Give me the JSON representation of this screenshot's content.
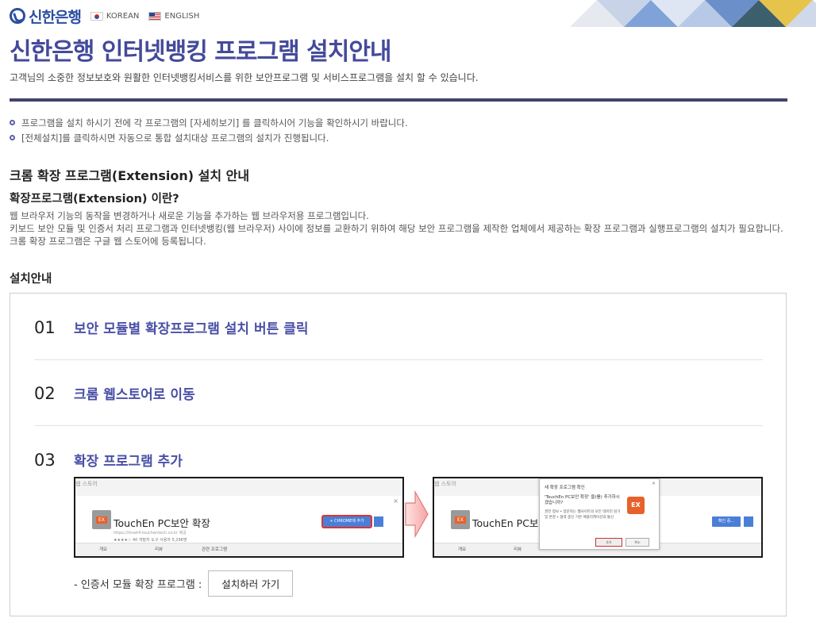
{
  "header": {
    "logo_text": "신한은행",
    "lang_korean": "KOREAN",
    "lang_english": "ENGLISH",
    "title": "신한은행 인터넷뱅킹 프로그램 설치안내",
    "subtitle": "고객님의 소중한 정보보호와 원활한 인터넷뱅킹서비스를 위한 보안프로그램 및 서비스프로그램을 설치 할 수 있습니다."
  },
  "notices": [
    "프로그램을 설치 하시기 전에 각 프로그램의 [자세히보기] 를 클릭하시어 기능을 확인하시기 바랍니다.",
    "[전체설치]를 클릭하시면 자동으로 통합 설치대상 프로그램의 설치가 진행됩니다."
  ],
  "extension": {
    "section_title": "크롬 확장 프로그램(Extension) 설치 안내",
    "question": "확장프로그램(Extension) 이란?",
    "desc_line1": "웹 브라우저 기능의 동작을 변경하거나 새로운 기능을 추가하는 웹 브라우저용 프로그램입니다.",
    "desc_line2": "키보드 보안 모듈 및 인증서 처리 프로그램과 인터넷뱅킹(웹 브라우저) 사이에 정보를 교환하기 위하여 해당 보안 프로그램을 제작한 업체에서 제공하는 확장 프로그램과 실행프로그램의 설치가 필요합니다. 크롬 확장 프로그램은 구글 웹 스토어에 등록됩니다."
  },
  "guide": {
    "title": "설치안내",
    "steps": [
      {
        "num": "01",
        "text": "보안 모듈별 확장프로그램 설치 버튼 클릭"
      },
      {
        "num": "02",
        "text": "크롬 웹스토어로 이동"
      },
      {
        "num": "03",
        "text": "확장 프로그램 추가"
      }
    ],
    "cert_label": "- 인증서 모듈 확장 프로그램 :",
    "cert_button": "설치하러 가기"
  },
  "screenshot": {
    "store_tab": "웹 스토어",
    "search_text": "추천",
    "ext_name": "TouchEn PC보안 확장",
    "ext_name_cut": "TouchEn PC보안",
    "ext_meta": "https://rknet4.touchentech.co.kr 제공",
    "ext_rating": "★★★★☆ 40  개발자 도구  사용자 5,296명",
    "add_button": "+ CHROME에 추가",
    "add_button2": "확인 중...",
    "tab_overview": "개요",
    "tab_reviews": "리뷰",
    "tab_related": "관련 프로그램",
    "dialog_title": "새 확장 프로그램 확인",
    "dialog_msg": "'TouchEn PC보안 확장' 을(를) 추가하시겠습니까?",
    "dialog_list": "권한 정보 • 방문하는 웹사이트의 모든 데이터 읽기 및 변경 • 협력 중인 기본 애플리케이션과 통신",
    "dialog_add": "추가",
    "dialog_cancel": "취소",
    "ex_badge": "EX"
  },
  "colors": {
    "title": "#444a9a",
    "rule": "#43436e",
    "step": "#4a50a6",
    "brand": "#2b4ea2"
  }
}
